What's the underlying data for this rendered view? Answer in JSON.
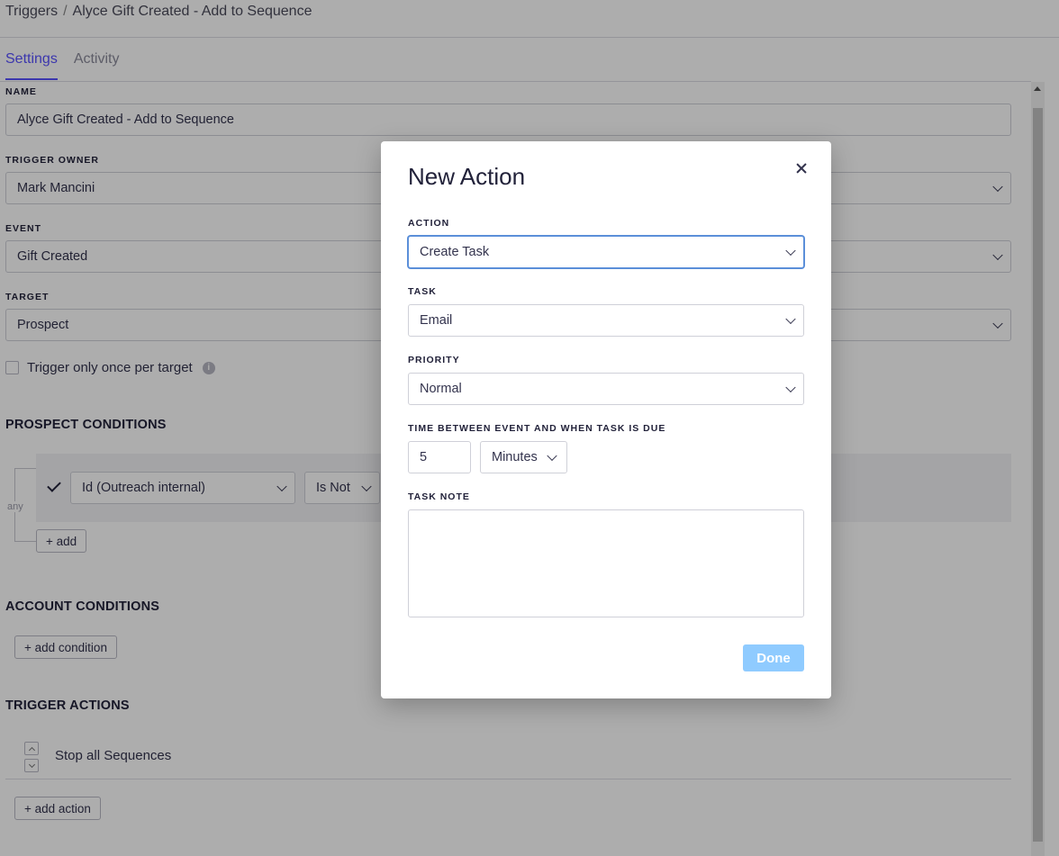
{
  "breadcrumb": {
    "root": "Triggers",
    "separator": "/",
    "current": "Alyce Gift Created - Add to Sequence"
  },
  "tabs": [
    {
      "label": "Settings",
      "active": true
    },
    {
      "label": "Activity",
      "active": false
    }
  ],
  "form": {
    "name_label": "NAME",
    "name_value": "Alyce Gift Created - Add to Sequence",
    "owner_label": "TRIGGER OWNER",
    "owner_value": "Mark Mancini",
    "event_label": "EVENT",
    "event_value": "Gift Created",
    "target_label": "TARGET",
    "target_value": "Prospect",
    "once_label": "Trigger only once per target",
    "once_checked": false
  },
  "prospect_conditions": {
    "title": "PROSPECT CONDITIONS",
    "group_label": "any",
    "condition_field": "Id (Outreach internal)",
    "condition_operator": "Is Not",
    "add_label": "+ add"
  },
  "account_conditions": {
    "title": "ACCOUNT CONDITIONS",
    "add_label": "+ add condition"
  },
  "trigger_actions": {
    "title": "TRIGGER ACTIONS",
    "items": [
      {
        "label": "Stop all Sequences"
      }
    ],
    "add_label": "+ add action"
  },
  "modal": {
    "title": "New Action",
    "action_label": "ACTION",
    "action_value": "Create Task",
    "task_label": "TASK",
    "task_value": "Email",
    "priority_label": "PRIORITY",
    "priority_value": "Normal",
    "time_label": "TIME BETWEEN EVENT AND WHEN TASK IS DUE",
    "time_value": "5",
    "time_unit": "Minutes",
    "note_label": "TASK NOTE",
    "note_value": "",
    "done_label": "Done"
  },
  "colors": {
    "accent": "#5951ff",
    "done_button": "#8fcbff",
    "focus_border": "#5b8fd9"
  }
}
